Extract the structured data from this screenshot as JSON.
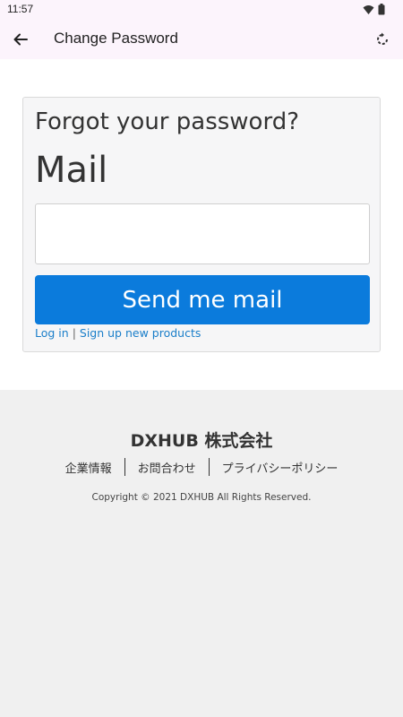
{
  "status_bar": {
    "time": "11:57"
  },
  "app_bar": {
    "title": "Change Password"
  },
  "form": {
    "title": "Forgot your password?",
    "mail_label": "Mail",
    "mail_value": "",
    "send_button": "Send me mail",
    "login_link": "Log in",
    "separator": "|",
    "signup_link": "Sign up new products"
  },
  "footer": {
    "company": "DXHUB 株式会社",
    "links": [
      "企業情報",
      "お問合わせ",
      "プライバシーポリシー"
    ],
    "copyright": "Copyright © 2021 DXHUB All Rights Reserved."
  },
  "colors": {
    "app_bar_bg": "#fcf4fc",
    "button_primary": "#0b7bdc",
    "link": "#1a7ec9",
    "footer_bg": "#f0f0f0"
  }
}
